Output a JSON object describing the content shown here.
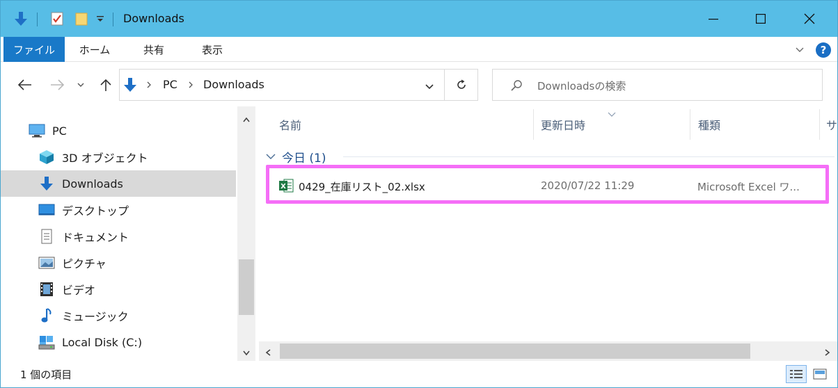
{
  "window": {
    "title": "Downloads",
    "accent_color": "#57bde6"
  },
  "ribbon": {
    "tabs": [
      {
        "label": "ファイル"
      },
      {
        "label": "ホーム"
      },
      {
        "label": "共有"
      },
      {
        "label": "表示"
      }
    ]
  },
  "address": {
    "segments": [
      "PC",
      "Downloads"
    ]
  },
  "search": {
    "placeholder": "Downloadsの検索"
  },
  "nav": {
    "items": [
      {
        "label": "PC",
        "icon": "pc-icon"
      },
      {
        "label": "3D オブジェクト",
        "icon": "3d-objects-icon"
      },
      {
        "label": "Downloads",
        "icon": "downloads-icon",
        "selected": true
      },
      {
        "label": "デスクトップ",
        "icon": "desktop-icon"
      },
      {
        "label": "ドキュメント",
        "icon": "documents-icon"
      },
      {
        "label": "ピクチャ",
        "icon": "pictures-icon"
      },
      {
        "label": "ビデオ",
        "icon": "videos-icon"
      },
      {
        "label": "ミュージック",
        "icon": "music-icon"
      },
      {
        "label": "Local Disk (C:)",
        "icon": "local-disk-icon"
      }
    ]
  },
  "content": {
    "columns": {
      "name": "名前",
      "date": "更新日時",
      "type": "種類",
      "size": "サ"
    },
    "group": {
      "label": "今日 (1)"
    },
    "files": [
      {
        "name": "0429_在庫リスト_02.xlsx",
        "modified": "2020/07/22 11:29",
        "type": "Microsoft Excel ワ...",
        "icon": "excel-file-icon"
      }
    ],
    "highlight_color": "#f56ef7"
  },
  "status": {
    "item_count": "1 個の項目"
  }
}
